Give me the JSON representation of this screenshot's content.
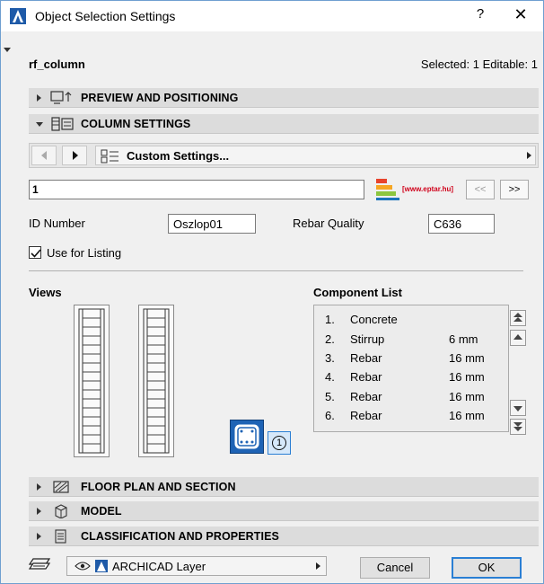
{
  "window": {
    "title": "Object Selection Settings",
    "help_glyph": "?",
    "close_glyph": "✕"
  },
  "object": {
    "name": "rf_column",
    "selection_info": "Selected: 1 Editable: 1"
  },
  "sections": {
    "preview": "PREVIEW AND POSITIONING",
    "column_settings": "COLUMN SETTINGS",
    "floor_plan": "FLOOR PLAN AND SECTION",
    "model": "MODEL",
    "classification": "CLASSIFICATION AND PROPERTIES"
  },
  "nav": {
    "custom_settings": "Custom Settings..."
  },
  "id_field": {
    "value": "1"
  },
  "logo": {
    "text": "[www.eptar.hu]"
  },
  "paging": {
    "prev": "<<",
    "next": ">>"
  },
  "params": {
    "id_number_label": "ID Number",
    "id_number_value": "Oszlop01",
    "rebar_quality_label": "Rebar Quality",
    "rebar_quality_value": "C636",
    "use_for_listing_label": "Use for Listing",
    "use_for_listing_checked": true
  },
  "views": {
    "label": "Views",
    "marker": "1"
  },
  "components": {
    "label": "Component List",
    "items": [
      {
        "num": "1.",
        "name": "Concrete",
        "size": ""
      },
      {
        "num": "2.",
        "name": "Stirrup",
        "size": "6 mm"
      },
      {
        "num": "3.",
        "name": "Rebar",
        "size": "16 mm"
      },
      {
        "num": "4.",
        "name": "Rebar",
        "size": "16 mm"
      },
      {
        "num": "5.",
        "name": "Rebar",
        "size": "16 mm"
      },
      {
        "num": "6.",
        "name": "Rebar",
        "size": "16 mm"
      }
    ]
  },
  "footer": {
    "layer": "ARCHICAD Layer",
    "cancel": "Cancel",
    "ok": "OK"
  },
  "colors": {
    "accent": "#2a7fd4",
    "section_bg": "#dcdcdc",
    "dialog_bg": "#f0f0f0"
  }
}
